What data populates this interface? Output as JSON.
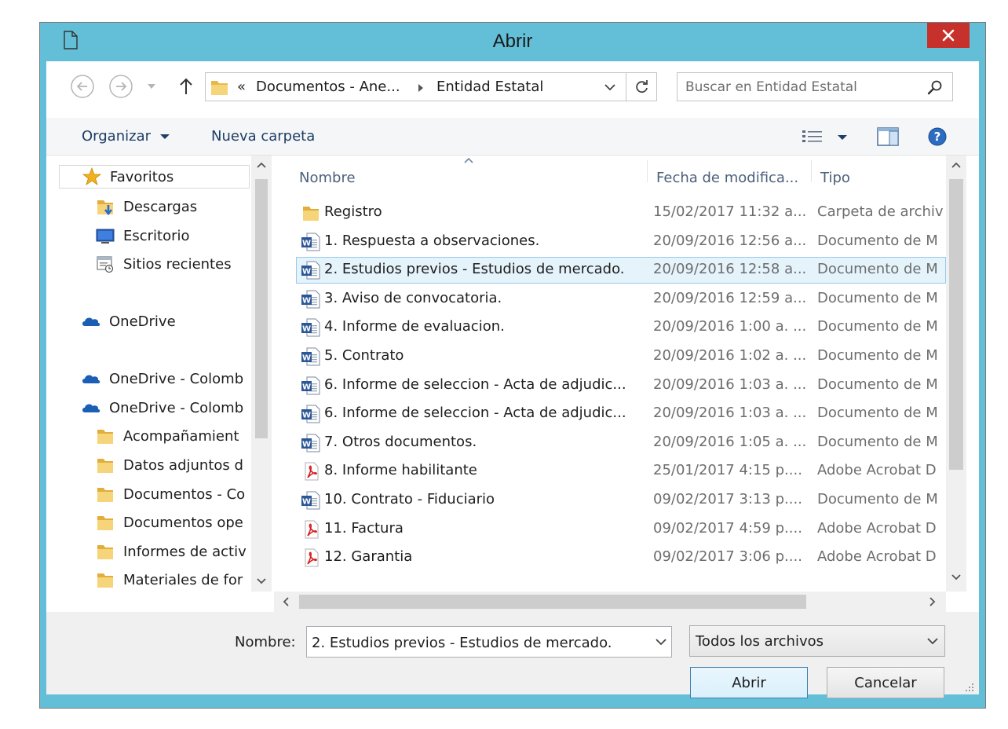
{
  "window": {
    "title": "Abrir"
  },
  "address": {
    "chevrons": "«",
    "crumbs": [
      "Documentos - Ane...",
      "Entidad Estatal"
    ]
  },
  "search": {
    "placeholder": "Buscar en Entidad Estatal"
  },
  "toolbar": {
    "organize_label": "Organizar",
    "new_folder_label": "Nueva carpeta"
  },
  "nav": {
    "items": [
      {
        "label": "Favoritos",
        "icon": "star-icon",
        "indent": false,
        "selected": true
      },
      {
        "label": "Descargas",
        "icon": "downloads-folder-icon",
        "indent": true
      },
      {
        "label": "Escritorio",
        "icon": "desktop-icon",
        "indent": true
      },
      {
        "label": "Sitios recientes",
        "icon": "recent-places-icon",
        "indent": true
      },
      {
        "label": "OneDrive",
        "icon": "onedrive-icon",
        "indent": false
      },
      {
        "label": "OneDrive - Colomb",
        "icon": "onedrive-icon",
        "indent": false
      },
      {
        "label": "OneDrive - Colomb",
        "icon": "onedrive-icon",
        "indent": false
      },
      {
        "label": "Acompañamient",
        "icon": "folder-icon",
        "indent": true
      },
      {
        "label": "Datos adjuntos d",
        "icon": "folder-icon",
        "indent": true
      },
      {
        "label": "Documentos - Co",
        "icon": "folder-icon",
        "indent": true
      },
      {
        "label": "Documentos ope",
        "icon": "folder-icon",
        "indent": true
      },
      {
        "label": "Informes de activ",
        "icon": "folder-icon",
        "indent": true
      },
      {
        "label": "Materiales de for",
        "icon": "folder-icon",
        "indent": true
      }
    ]
  },
  "columns": {
    "name": "Nombre",
    "date": "Fecha de modifica...",
    "type": "Tipo"
  },
  "files": [
    {
      "name": "Registro",
      "date": "15/02/2017 11:32 a...",
      "type": "Carpeta de archiv",
      "icon": "folder-icon"
    },
    {
      "name": "1. Respuesta a observaciones.",
      "date": "20/09/2016 12:56 a...",
      "type": "Documento de M",
      "icon": "word-doc-icon"
    },
    {
      "name": "2. Estudios previos - Estudios de mercado.",
      "date": "20/09/2016 12:58 a...",
      "type": "Documento de M",
      "icon": "word-doc-icon",
      "selected": true
    },
    {
      "name": "3. Aviso de convocatoria.",
      "date": "20/09/2016 12:59 a...",
      "type": "Documento de M",
      "icon": "word-doc-icon"
    },
    {
      "name": "4. Informe de evaluacion.",
      "date": "20/09/2016 1:00 a. ...",
      "type": "Documento de M",
      "icon": "word-doc-icon"
    },
    {
      "name": "5. Contrato",
      "date": "20/09/2016 1:02 a. ...",
      "type": "Documento de M",
      "icon": "word-doc-icon"
    },
    {
      "name": "6. Informe de seleccion - Acta de adjudic...",
      "date": "20/09/2016 1:03 a. ...",
      "type": "Documento de M",
      "icon": "word-doc-icon"
    },
    {
      "name": "6. Informe de seleccion - Acta de adjudic...",
      "date": "20/09/2016 1:03 a. ...",
      "type": "Documento de M",
      "icon": "word-doc-icon"
    },
    {
      "name": "7. Otros documentos.",
      "date": "20/09/2016 1:05 a. ...",
      "type": "Documento de M",
      "icon": "word-doc-icon"
    },
    {
      "name": "8. Informe habilitante",
      "date": "25/01/2017 4:15 p....",
      "type": "Adobe Acrobat D",
      "icon": "pdf-icon"
    },
    {
      "name": "10. Contrato - Fiduciario",
      "date": "09/02/2017 3:13 p....",
      "type": "Documento de M",
      "icon": "word-doc-icon"
    },
    {
      "name": "11. Factura",
      "date": "09/02/2017 4:59 p....",
      "type": "Adobe Acrobat D",
      "icon": "pdf-icon"
    },
    {
      "name": "12. Garantia",
      "date": "09/02/2017 3:06 p....",
      "type": "Adobe Acrobat D",
      "icon": "pdf-icon"
    }
  ],
  "bottom": {
    "name_label": "Nombre:",
    "name_value": "2. Estudios previos - Estudios de mercado.",
    "type_value": "Todos los archivos",
    "open_label": "Abrir",
    "cancel_label": "Cancelar"
  },
  "colors": {
    "frame": "#63bfd8",
    "close": "#c7312b",
    "selection_fill": "#e5f3fb",
    "selection_border": "#99c9ef",
    "link_text": "#1e3d66"
  }
}
